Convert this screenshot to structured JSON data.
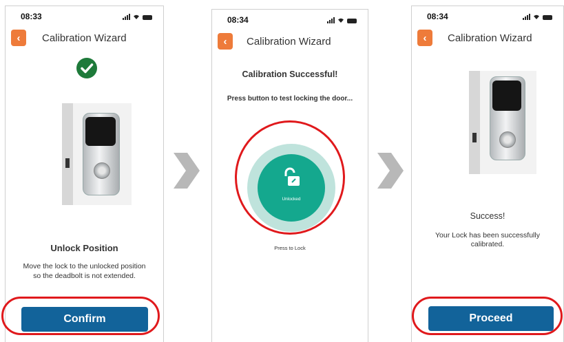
{
  "screen1": {
    "time": "08:33",
    "title": "Calibration Wizard",
    "heading": "Unlock Position",
    "desc_line1": "Move the lock to the unlocked position",
    "desc_line2": "so the deadbolt is not extended.",
    "button": "Confirm"
  },
  "screen2": {
    "time": "08:34",
    "title": "Calibration Wizard",
    "heading": "Calibration Successful!",
    "instruction": "Press button to test locking the door...",
    "state": "Unlocked",
    "caption": "Press to Lock"
  },
  "screen3": {
    "time": "08:34",
    "title": "Calibration Wizard",
    "heading": "Success!",
    "msg_line1": "Your Lock has been successfully",
    "msg_line2": "calibrated.",
    "button": "Proceed"
  },
  "colors": {
    "accent": "#ee7b3a",
    "primary": "#12639a",
    "teal": "#14a88e",
    "highlight": "#e0191c",
    "check": "#1e7a3a"
  }
}
